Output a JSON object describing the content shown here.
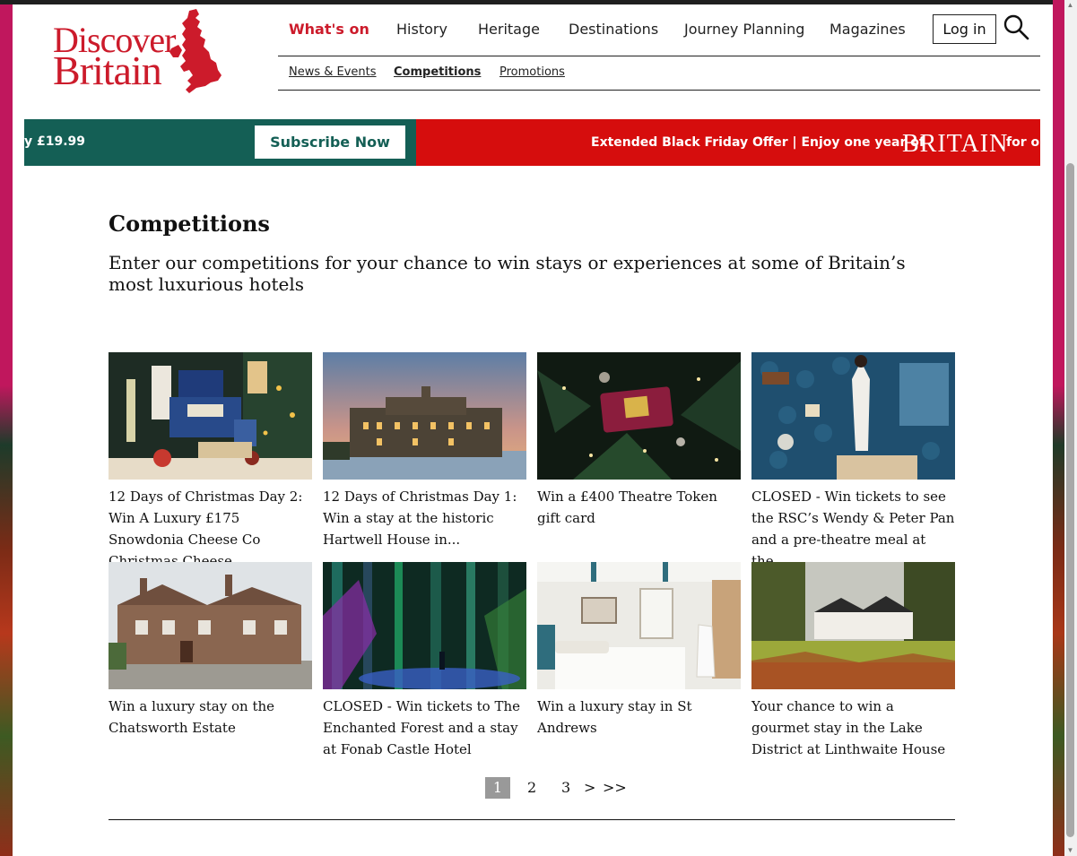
{
  "colors": {
    "brand_red": "#cc1b2b",
    "banner_green": "#145f55",
    "banner_red": "#d60d0d",
    "text": "#111111"
  },
  "logo": {
    "line1": "Discover",
    "line2": "Britain",
    "map_icon": "uk-map-icon"
  },
  "nav": {
    "items": [
      {
        "label": "What's on",
        "active": true
      },
      {
        "label": "History"
      },
      {
        "label": "Heritage"
      },
      {
        "label": "Destinations"
      },
      {
        "label": "Journey Planning"
      },
      {
        "label": "Magazines"
      }
    ],
    "login_label": "Log in",
    "search_icon": "search-icon"
  },
  "subnav": {
    "items": [
      {
        "label": "News & Events"
      },
      {
        "label": "Competitions",
        "active": true
      },
      {
        "label": "Promotions"
      }
    ]
  },
  "banner": {
    "price_text": "y £19.99",
    "subscribe_label": "Subscribe Now",
    "offer_text": "Extended Black Friday Offer | Enjoy one year of",
    "brand_text": "BRITAIN",
    "tail_text": "for o"
  },
  "page": {
    "title": "Competitions",
    "intro": "Enter our competitions for your chance to win stays or experiences at some of Britain’s most luxurious hotels"
  },
  "cards": [
    {
      "title": "12 Days of Christmas Day 2: Win A Luxury £175 Snowdonia Cheese Co Christmas Cheese,..."
    },
    {
      "title": "12 Days of Christmas Day 1: Win a stay at the historic Hartwell House in..."
    },
    {
      "title": "Win a £400 Theatre Token gift card"
    },
    {
      "title": "CLOSED - Win tickets to see the RSC’s Wendy & Peter Pan and a pre-theatre meal at the..."
    },
    {
      "title": "Win a luxury stay on the Chatsworth Estate"
    },
    {
      "title": "CLOSED - Win tickets to The Enchanted Forest and a stay at Fonab Castle Hotel"
    },
    {
      "title": "Win a luxury stay in St Andrews"
    },
    {
      "title": "Your chance to win a gourmet stay in the Lake District at Linthwaite House"
    }
  ],
  "pagination": {
    "pages": [
      "1",
      "2",
      "3"
    ],
    "current": "1",
    "next_label": ">",
    "last_label": ">>"
  }
}
